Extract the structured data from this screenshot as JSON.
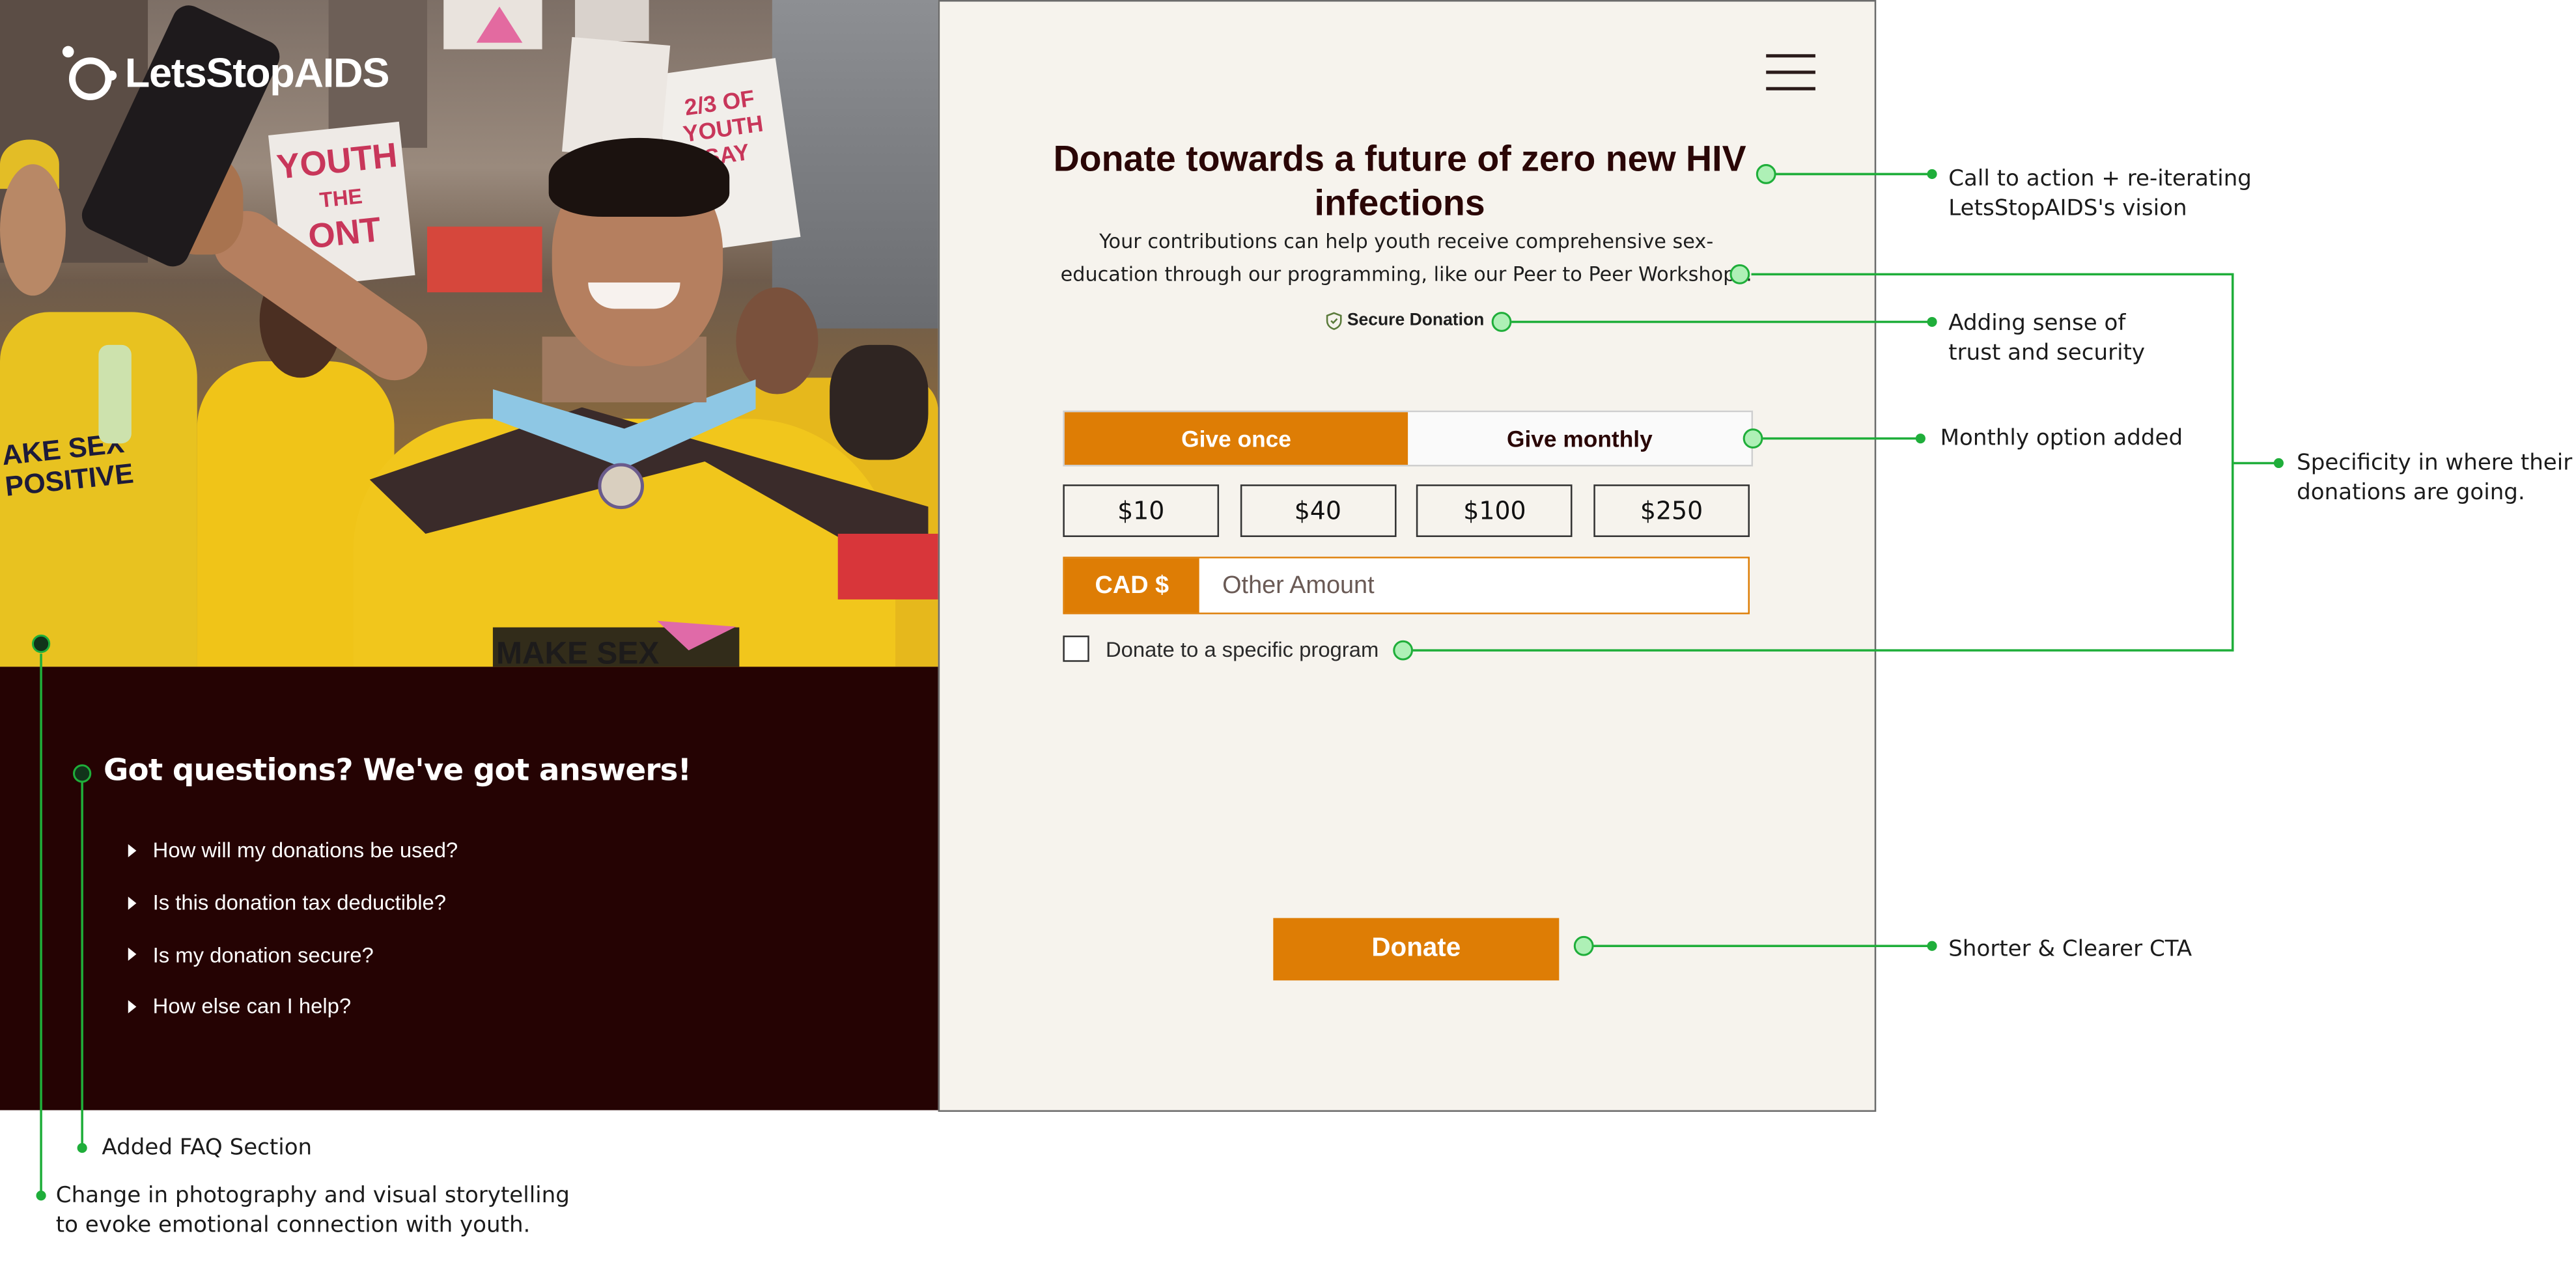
{
  "brand": {
    "name": "LetsStopAIDS",
    "accent": "#de7d05",
    "dark": "#250303",
    "annotation_color": "#1fae3a"
  },
  "hero": {
    "banner_sign_1": "YOUTH",
    "banner_sign_1b": "THE",
    "banner_sign_1c": "ONT",
    "banner_sign_2": "2/3 OF",
    "banner_sign_2b": "YOUTH SAY",
    "shirt_left": "AKE SEX",
    "shirt_left_b": "POSITIVE",
    "shirt_front": "MAKE SEX"
  },
  "faq": {
    "title": "Got questions? We've got answers!",
    "items": [
      "How will my donations be used?",
      "Is this donation tax deductible?",
      "Is my donation secure?",
      "How else can I help?"
    ]
  },
  "form": {
    "headline": "Donate towards a future of zero new HIV infections",
    "subtext": "Your contributions can help youth receive comprehensive sex-education through our programming, like our Peer to Peer Workshops.",
    "secure_label": "Secure Donation",
    "tabs": [
      {
        "label": "Give once",
        "active": true
      },
      {
        "label": "Give monthly",
        "active": false
      }
    ],
    "amounts": [
      "$10",
      "$40",
      "$100",
      "$250"
    ],
    "currency_label": "CAD $",
    "other_placeholder": "Other Amount",
    "program_label": "Donate to a specific program",
    "program_checked": false,
    "donate_label": "Donate"
  },
  "annotations": {
    "cta": [
      "Call to action + re-iterating",
      "LetsStopAIDS's vision"
    ],
    "trust": [
      "Adding sense of",
      "trust and security"
    ],
    "monthly": [
      "Monthly option added"
    ],
    "specificity": [
      "Specificity in where their",
      "donations are going."
    ],
    "shorter": [
      "Shorter & Clearer CTA"
    ],
    "faq": [
      "Added FAQ Section"
    ],
    "photo": [
      "Change in photography and visual storytelling",
      "to evoke emotional connection with youth."
    ]
  }
}
